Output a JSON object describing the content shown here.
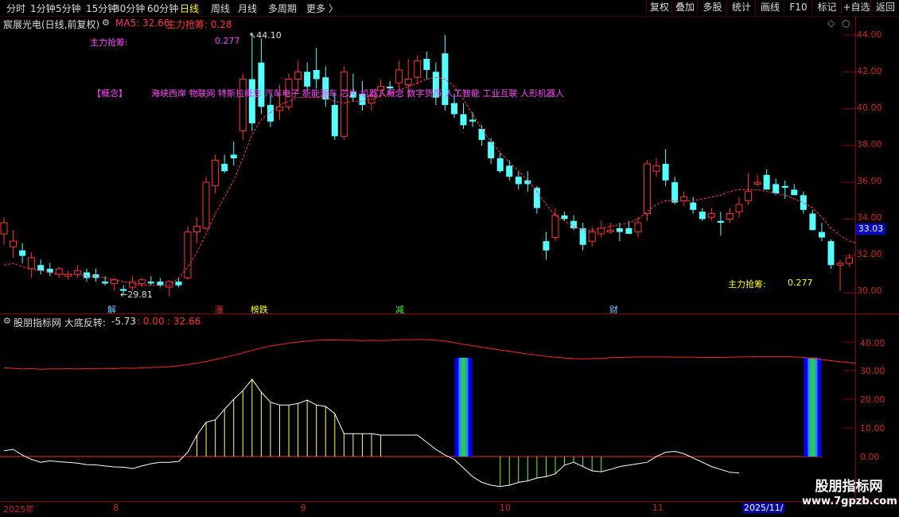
{
  "toolbar": {
    "periods": [
      {
        "label": "分时",
        "active": false
      },
      {
        "label": "1分钟",
        "active": false
      },
      {
        "label": "5分钟",
        "active": false
      },
      {
        "label": "15分钟",
        "active": false
      },
      {
        "label": "30分钟",
        "active": false
      },
      {
        "label": "60分钟",
        "active": false
      },
      {
        "label": "日线",
        "active": true
      },
      {
        "label": "周线",
        "active": false
      },
      {
        "label": "月线",
        "active": false
      },
      {
        "label": "多周期",
        "active": false
      },
      {
        "label": "更多 〉",
        "active": false
      }
    ],
    "buttons": [
      "复权",
      "叠加",
      "多股",
      "统计",
      "画线",
      "F10",
      "标记",
      "+自选",
      "返回"
    ]
  },
  "header": {
    "stock": "宸展光电(日线,前复权)",
    "ma_label": "MA5: 32.66",
    "zl_label": "主力抢筹: 0.28"
  },
  "main": {
    "zl_title": "主力抢筹:",
    "zl_value": "0.277",
    "concept_tag": "【概念】",
    "concepts": "海峡西岸 物联网 特斯拉概念 汽车电子 新能源车 芯片 机器人概念 数字货币 人工智能 工业互联 人形机器人",
    "zl_bottom_title": "主力抢筹:",
    "zl_bottom_value": "0.277",
    "high_label": "44.10",
    "low_label": "29.81",
    "price_axis": [
      "44.00",
      "42.00",
      "40.00",
      "38.00",
      "36.00",
      "34.00",
      "32.00",
      "30.00"
    ],
    "current_price": "33.03",
    "signals": [
      {
        "text": "解",
        "color": "#66ccff"
      },
      {
        "text": "涨",
        "color": "#ff3333"
      },
      {
        "text": "榜跌",
        "color": "#ffff00"
      },
      {
        "text": "减",
        "color": "#33ff33"
      },
      {
        "text": "财",
        "color": "#66ccff"
      }
    ]
  },
  "indicator": {
    "title": "股朋指标网 大底反转:",
    "v1": "-5.73",
    "v2": ": 0.00",
    "v3": ": 32.66",
    "axis": [
      "40.00",
      "30.00",
      "20.00",
      "10.00",
      "0.00"
    ]
  },
  "dates": [
    "2025年",
    "8",
    "9",
    "10",
    "11",
    "2025/11/"
  ],
  "watermark": {
    "title": "股朋指标网",
    "url": "www.7gpzb.com"
  },
  "colors": {
    "up": "#ff3333",
    "down": "#55ffff",
    "ma": "#ff3366",
    "axis": "#cc2222"
  },
  "chart_data": {
    "type": "candlestick",
    "ylim": [
      30,
      44
    ],
    "candles": [
      [
        33.2,
        34.1,
        32.6,
        33.8
      ],
      [
        32.5,
        33.4,
        31.9,
        32.8
      ],
      [
        32.3,
        32.7,
        31.6,
        32.0
      ],
      [
        31.3,
        32.2,
        30.8,
        31.9
      ],
      [
        31.5,
        31.8,
        31.0,
        31.2
      ],
      [
        31.3,
        31.6,
        30.9,
        31.1
      ],
      [
        31.0,
        31.4,
        30.8,
        31.3
      ],
      [
        30.9,
        31.2,
        30.7,
        31.0
      ],
      [
        31.0,
        31.5,
        30.8,
        31.2
      ],
      [
        31.1,
        31.3,
        30.6,
        30.8
      ],
      [
        31.0,
        31.3,
        30.6,
        30.8
      ],
      [
        30.6,
        30.9,
        30.4,
        30.5
      ],
      [
        30.5,
        30.8,
        30.1,
        30.7
      ],
      [
        30.2,
        30.4,
        29.9,
        30.1
      ],
      [
        30.3,
        30.9,
        30.1,
        30.6
      ],
      [
        30.5,
        30.8,
        30.3,
        30.7
      ],
      [
        30.6,
        30.9,
        30.4,
        30.5
      ],
      [
        30.6,
        30.8,
        30.3,
        30.4
      ],
      [
        30.3,
        30.7,
        29.8,
        30.6
      ],
      [
        30.6,
        30.8,
        30.3,
        30.4
      ],
      [
        30.8,
        33.6,
        30.7,
        33.3
      ],
      [
        33.3,
        34.1,
        32.7,
        33.6
      ],
      [
        33.5,
        36.3,
        33.4,
        36.0
      ],
      [
        35.8,
        37.5,
        35.4,
        37.2
      ],
      [
        37.0,
        37.5,
        36.5,
        36.6
      ],
      [
        37.5,
        38.2,
        36.9,
        37.3
      ],
      [
        38.8,
        41.9,
        38.3,
        41.6
      ],
      [
        41.6,
        44.1,
        38.8,
        39.2
      ],
      [
        42.5,
        43.8,
        39.7,
        40.1
      ],
      [
        40.2,
        40.8,
        39.0,
        39.3
      ],
      [
        39.9,
        41.3,
        39.4,
        40.1
      ],
      [
        40.1,
        41.9,
        39.9,
        41.6
      ],
      [
        41.6,
        42.6,
        40.9,
        42.0
      ],
      [
        42.0,
        42.5,
        41.0,
        41.2
      ],
      [
        42.1,
        43.3,
        41.1,
        41.6
      ],
      [
        41.7,
        42.3,
        40.1,
        40.5
      ],
      [
        40.2,
        40.9,
        38.3,
        38.5
      ],
      [
        38.5,
        42.3,
        38.3,
        42.0
      ],
      [
        40.9,
        41.9,
        40.4,
        40.6
      ],
      [
        40.8,
        41.5,
        39.9,
        40.2
      ],
      [
        40.3,
        41.0,
        39.9,
        40.7
      ],
      [
        41.0,
        41.6,
        40.6,
        41.2
      ],
      [
        41.2,
        41.5,
        40.8,
        41.1
      ],
      [
        41.4,
        42.6,
        41.0,
        42.1
      ],
      [
        41.3,
        42.7,
        40.6,
        41.6
      ],
      [
        41.7,
        42.9,
        41.3,
        42.6
      ],
      [
        42.7,
        43.1,
        41.6,
        42.1
      ],
      [
        42.0,
        42.5,
        40.2,
        40.6
      ],
      [
        43.0,
        44.0,
        39.9,
        40.2
      ],
      [
        40.3,
        40.8,
        39.5,
        39.7
      ],
      [
        39.7,
        40.3,
        38.9,
        39.1
      ],
      [
        39.4,
        39.8,
        39.0,
        39.3
      ],
      [
        38.9,
        39.1,
        38.0,
        38.3
      ],
      [
        38.2,
        38.4,
        37.0,
        37.3
      ],
      [
        37.3,
        37.6,
        36.5,
        36.6
      ],
      [
        36.9,
        37.2,
        36.1,
        36.3
      ],
      [
        36.3,
        36.6,
        35.6,
        35.9
      ],
      [
        36.1,
        36.6,
        35.5,
        35.9
      ],
      [
        35.7,
        35.8,
        34.3,
        34.6
      ],
      [
        32.8,
        33.3,
        31.8,
        32.3
      ],
      [
        33.0,
        34.6,
        32.8,
        34.2
      ],
      [
        34.2,
        34.4,
        33.9,
        34.0
      ],
      [
        33.9,
        34.2,
        33.4,
        33.5
      ],
      [
        33.5,
        33.8,
        32.3,
        32.6
      ],
      [
        32.8,
        33.6,
        32.5,
        33.3
      ],
      [
        33.2,
        33.9,
        33.0,
        33.5
      ],
      [
        33.3,
        33.8,
        33.2,
        33.4
      ],
      [
        33.5,
        33.8,
        32.8,
        33.3
      ],
      [
        33.5,
        33.9,
        33.2,
        33.2
      ],
      [
        33.3,
        34.1,
        33.0,
        33.8
      ],
      [
        34.3,
        37.2,
        33.9,
        37.0
      ],
      [
        36.6,
        37.3,
        36.3,
        36.9
      ],
      [
        37.0,
        37.8,
        35.8,
        36.1
      ],
      [
        36.0,
        36.3,
        34.8,
        34.9
      ],
      [
        35.0,
        35.5,
        34.7,
        35.2
      ],
      [
        34.9,
        35.2,
        34.3,
        34.5
      ],
      [
        34.4,
        34.6,
        33.9,
        34.0
      ],
      [
        34.1,
        34.6,
        33.9,
        34.3
      ],
      [
        33.9,
        34.4,
        33.1,
        33.8
      ],
      [
        34.0,
        34.6,
        33.8,
        34.3
      ],
      [
        34.4,
        35.2,
        34.1,
        34.8
      ],
      [
        35.0,
        36.5,
        34.8,
        35.5
      ],
      [
        35.9,
        36.4,
        35.8,
        36.0
      ],
      [
        36.4,
        36.7,
        36.0,
        35.6
      ],
      [
        35.9,
        36.2,
        35.3,
        35.4
      ],
      [
        35.8,
        36.1,
        35.1,
        35.7
      ],
      [
        35.6,
        35.9,
        35.3,
        35.3
      ],
      [
        35.3,
        35.5,
        34.3,
        34.5
      ],
      [
        34.3,
        34.5,
        33.4,
        33.4
      ],
      [
        33.3,
        33.8,
        32.8,
        33.0
      ],
      [
        32.8,
        32.9,
        31.3,
        31.5
      ],
      [
        31.5,
        31.8,
        30.1,
        31.6
      ],
      [
        31.6,
        32.1,
        31.4,
        31.9
      ],
      [
        32.0,
        32.4,
        31.6,
        32.2
      ],
      [
        32.0,
        32.5,
        31.7,
        32.3
      ],
      [
        32.3,
        33.0,
        32.1,
        33.03
      ]
    ],
    "ma5": [
      31.5,
      31.6,
      31.4,
      31.3,
      31.2,
      31.1,
      31.0,
      31.0,
      31.0,
      30.9,
      30.9,
      30.8,
      30.7,
      30.6,
      30.5,
      30.4,
      30.4,
      30.4,
      30.4,
      30.8,
      31.4,
      32.2,
      33.2,
      34.3,
      35.2,
      36.1,
      37.3,
      38.6,
      39.4,
      39.8,
      40.2,
      40.4,
      40.6,
      40.6,
      40.6,
      40.6,
      40.4,
      40.3,
      40.4,
      40.4,
      40.5,
      40.7,
      40.8,
      41.0,
      41.2,
      41.4,
      41.6,
      41.7,
      41.6,
      41.2,
      40.5,
      39.7,
      38.9,
      38.2,
      37.6,
      37.1,
      36.6,
      36.1,
      35.5,
      34.8,
      34.2,
      33.9,
      33.6,
      33.4,
      33.4,
      33.5,
      33.6,
      33.7,
      33.8,
      34.0,
      34.4,
      34.8,
      35.0,
      35.0,
      35.0,
      35.0,
      35.1,
      35.2,
      35.3,
      35.5,
      35.6,
      35.6,
      35.6,
      35.5,
      35.4,
      35.3,
      35.1,
      34.9,
      34.6,
      34.1,
      33.5,
      33.1,
      32.8,
      32.7,
      32.7,
      33.0
    ],
    "indicator": {
      "ylim": [
        -12,
        46
      ],
      "red_line": [
        31.0,
        30.8,
        30.6,
        30.7,
        30.5,
        30.6,
        30.6,
        30.7,
        30.6,
        30.7,
        30.6,
        30.8,
        30.7,
        30.9,
        30.8,
        31.0,
        31.1,
        31.2,
        31.4,
        31.7,
        32.1,
        32.6,
        33.2,
        33.9,
        34.6,
        35.4,
        36.2,
        37.1,
        37.9,
        38.6,
        39.1,
        39.6,
        40.0,
        40.3,
        40.6,
        40.7,
        40.7,
        40.6,
        40.6,
        40.5,
        40.6,
        40.5,
        40.6,
        40.8,
        40.8,
        40.9,
        40.8,
        40.6,
        40.3,
        39.8,
        39.2,
        38.7,
        38.2,
        37.7,
        37.2,
        36.8,
        36.3,
        35.8,
        35.4,
        35.0,
        34.7,
        34.4,
        34.2,
        34.1,
        34.2,
        34.3,
        34.5,
        34.6,
        34.7,
        34.8,
        34.8,
        34.8,
        34.8,
        34.7,
        34.7,
        34.7,
        34.6,
        34.6,
        34.6,
        34.7,
        34.8,
        34.8,
        34.9,
        34.9,
        34.9,
        34.9,
        34.8,
        34.6,
        34.3,
        33.9,
        33.5,
        33.1,
        32.8,
        32.6,
        32.7,
        32.6
      ],
      "white_line": [
        2.0,
        2.5,
        0.5,
        -1.0,
        -2.0,
        -1.5,
        -1.8,
        -2.0,
        -2.3,
        -2.8,
        -2.9,
        -3.3,
        -3.6,
        -3.7,
        -4.2,
        -3.3,
        -2.5,
        -2.0,
        -2.0,
        -1.7,
        1.5,
        7.5,
        12.0,
        12.8,
        16.5,
        20.0,
        23.0,
        27.0,
        22.5,
        19.0,
        18.0,
        18.0,
        18.5,
        19.7,
        18.0,
        17.5,
        15.0,
        8.0,
        8.0,
        8.0,
        8.0,
        7.5,
        7.5,
        7.5,
        7.5,
        7.5,
        5.0,
        2.5,
        0.5,
        -1.0,
        -4.0,
        -7.0,
        -9.0,
        -10.0,
        -10.5,
        -10.0,
        -9.0,
        -8.5,
        -7.5,
        -7.0,
        -6.0,
        -3.0,
        -2.0,
        -3.5,
        -5.0,
        -5.3,
        -4.5,
        -3.5,
        -3.0,
        -2.5,
        -2.0,
        0.0,
        1.5,
        1.8,
        1.0,
        -0.5,
        -2.0,
        -3.5,
        -4.5,
        -5.5,
        -5.73
      ],
      "signal_bars": [
        50,
        88
      ]
    }
  }
}
